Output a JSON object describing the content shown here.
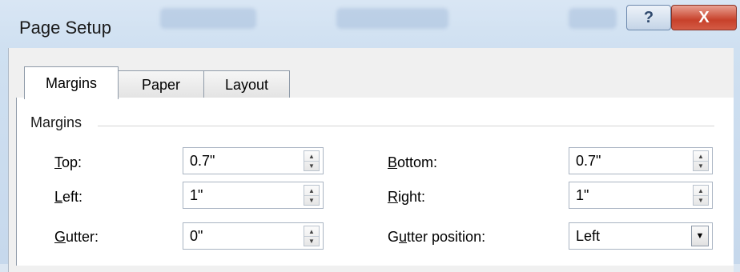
{
  "window": {
    "title": "Page Setup",
    "help_glyph": "?",
    "close_glyph": "X"
  },
  "tabs": [
    {
      "label": "Margins",
      "active": true
    },
    {
      "label": "Paper",
      "active": false
    },
    {
      "label": "Layout",
      "active": false
    }
  ],
  "margins": {
    "group_label": "Margins",
    "top": {
      "label_key": "T",
      "label_rest": "op:",
      "value": "0.7\""
    },
    "bottom": {
      "label_key": "B",
      "label_rest": "ottom:",
      "value": "0.7\""
    },
    "left": {
      "label_key": "L",
      "label_rest": "eft:",
      "value": "1\""
    },
    "right": {
      "label_key": "R",
      "label_rest": "ight:",
      "value": "1\""
    },
    "gutter": {
      "label_key": "G",
      "label_rest": "utter:",
      "value": "0\""
    },
    "gutter_position": {
      "label_pre": "G",
      "label_key": "u",
      "label_rest": "tter position:",
      "value": "Left"
    }
  },
  "icons": {
    "spin_up": "▲",
    "spin_down": "▼",
    "dropdown": "▼"
  }
}
